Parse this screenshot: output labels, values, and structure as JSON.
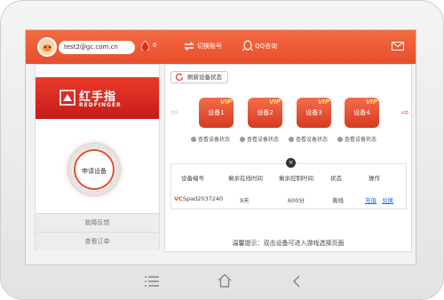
{
  "header": {
    "account": "test2@gc.com.cn",
    "count": "0",
    "switch_account": "切换账号",
    "qq_consult": "QQ咨询"
  },
  "brand": {
    "name_cn": "红手指",
    "name_en": "REDFINGER"
  },
  "left_menu": {
    "apply_device": "申请设备",
    "feedback": "故障反馈",
    "view_orders": "查看订单"
  },
  "toolbar": {
    "refresh_label": "刷新设备状态"
  },
  "devices": [
    {
      "label": "设备1",
      "badge": "VIP",
      "status_link": "查看设备状态"
    },
    {
      "label": "设备2",
      "badge": "VIP",
      "status_link": "查看设备状态"
    },
    {
      "label": "设备3",
      "badge": "VIP",
      "status_link": "查看设备状态"
    },
    {
      "label": "设备4",
      "badge": "VIP",
      "status_link": "查看设备状态"
    }
  ],
  "table": {
    "headers": [
      "设备编号",
      "剩余在线时间",
      "剩余控制时间",
      "状态",
      "操作"
    ],
    "row": {
      "id_prefix": "VC",
      "id_rest": "Spad2037240",
      "online_time": "9天",
      "control_time": "600分",
      "status": "离线",
      "op_recharge": "充值",
      "op_redeem": "兑换"
    }
  },
  "tip": "温馨提示：双击设备可进入游戏选择页面",
  "colors": {
    "accent": "#e94e2b",
    "brand_red": "#d32a20",
    "link": "#2a6fd6"
  },
  "icons": [
    "drop-icon",
    "switch-account-icon",
    "qq-icon",
    "mail-icon",
    "refresh-icon",
    "arrow-left-icon",
    "arrow-right-icon",
    "menu-icon",
    "home-icon",
    "back-icon"
  ]
}
